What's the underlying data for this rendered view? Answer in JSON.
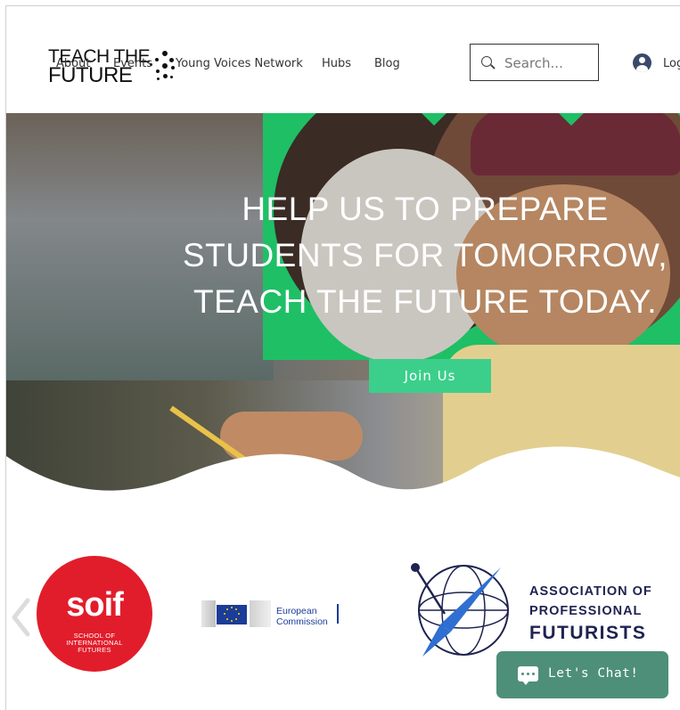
{
  "logo": {
    "line1": "TEACH THE",
    "line2": "FUTURE"
  },
  "nav": {
    "items": [
      "About",
      "Events",
      "Young Voices Network",
      "Hubs",
      "Blog"
    ]
  },
  "search": {
    "placeholder": "Search..."
  },
  "login": {
    "label": "Log"
  },
  "hero": {
    "title_lines": [
      "HELP US TO PREPARE",
      "STUDENTS FOR TOMORROW,",
      "TEACH THE FUTURE TODAY."
    ],
    "cta_label": "Join Us"
  },
  "partners": {
    "soif": {
      "name": "soif",
      "subtitle": "SCHOOL OF INTERNATIONAL FUTURES"
    },
    "ec": {
      "line1": "European",
      "line2": "Commission"
    },
    "apf": {
      "line1": "ASSOCIATION OF",
      "line2": "PROFESSIONAL",
      "line3": "FUTURISTS"
    }
  },
  "chat": {
    "label": "Let's Chat!"
  },
  "colors": {
    "green": "#1fbf66",
    "cta": "#3ccf8b",
    "chat": "#4e8f7a",
    "soif_red": "#e21d2b",
    "apf_navy": "#1e2350"
  }
}
